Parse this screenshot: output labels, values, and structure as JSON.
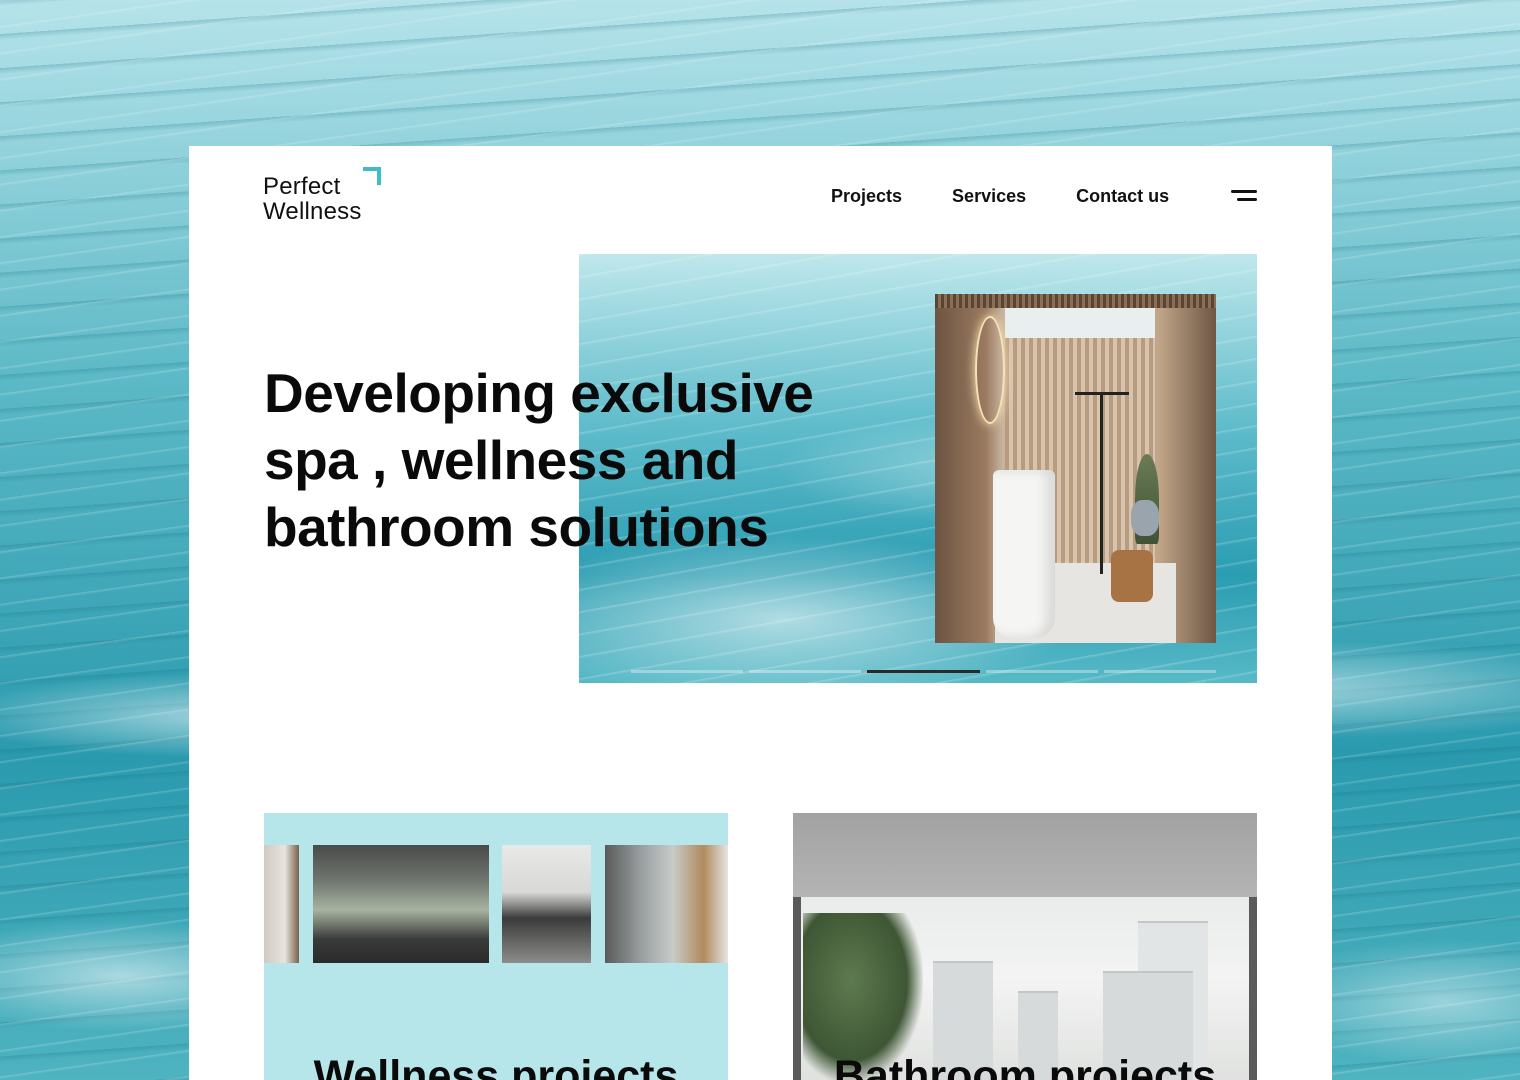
{
  "brand": {
    "line1": "Perfect",
    "line2": "Wellness",
    "accent_color": "#3fbcc8"
  },
  "nav": {
    "items": [
      {
        "label": "Projects"
      },
      {
        "label": "Services"
      },
      {
        "label": "Contact us"
      }
    ],
    "menu_icon": "menu-icon"
  },
  "hero": {
    "title": "Developing exclusive spa , wellness and bathroom solutions",
    "slider": {
      "slide_count": 5,
      "active_slide": 3
    }
  },
  "cards": [
    {
      "title": "Wellness projects",
      "bg_color": "#b6e6ea"
    },
    {
      "title": "Bathroom projects",
      "bg_color": "#cfcfcf"
    }
  ]
}
